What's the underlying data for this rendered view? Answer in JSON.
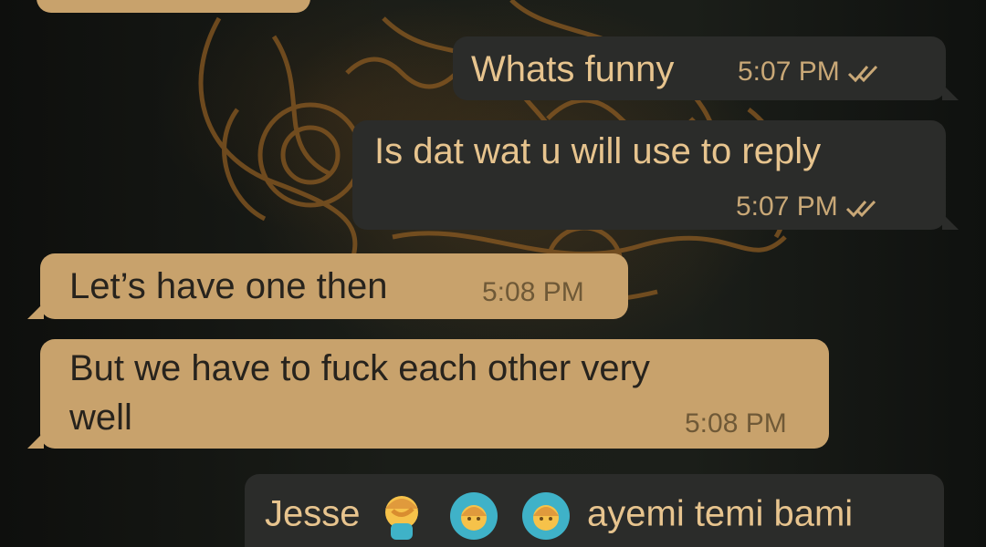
{
  "messages": [
    {
      "id": 1,
      "direction": "outgoing",
      "text": "Whats funny",
      "time": "5:07 PM",
      "status": "read"
    },
    {
      "id": 2,
      "direction": "outgoing",
      "text": "Is dat wat u will use to reply",
      "time": "5:07 PM",
      "status": "read"
    },
    {
      "id": 3,
      "direction": "incoming",
      "text": "Let’s have one then",
      "time": "5:08 PM"
    },
    {
      "id": 4,
      "direction": "incoming",
      "text_line1": "But we have to fuck each other very",
      "text_line2": "well",
      "time": "5:08 PM"
    },
    {
      "id": 5,
      "direction": "outgoing",
      "text_before_emoji": "Jesse",
      "emojis": [
        "woman-facepalming-emoji",
        "woman-gesturing-ok-emoji",
        "woman-gesturing-ok-emoji"
      ],
      "text_after_emoji": "ayemi temi bami"
    }
  ],
  "colors": {
    "incoming_bubble": "#c8a26c",
    "outgoing_bubble": "#2b2c2a",
    "outgoing_text": "#e7c48e",
    "incoming_text": "#27231d",
    "read_ticks": "#c9a877"
  },
  "icons": {
    "read_status": "double-check-icon"
  }
}
